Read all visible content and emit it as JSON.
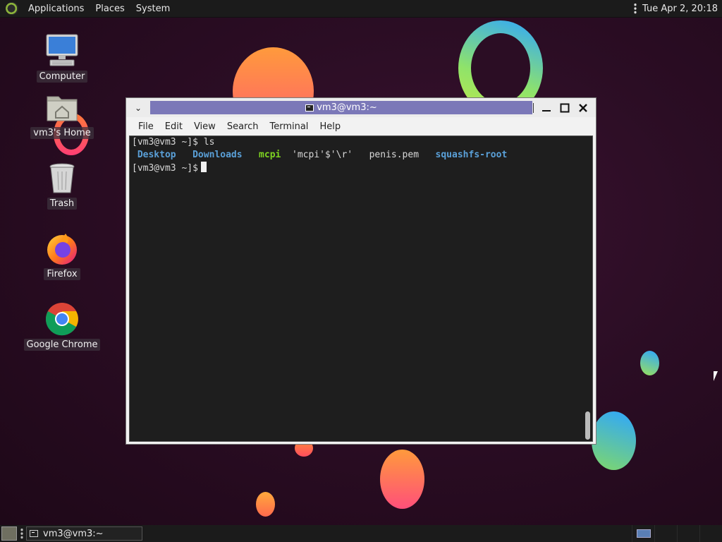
{
  "top_panel": {
    "menus": [
      "Applications",
      "Places",
      "System"
    ],
    "clock": "Tue Apr  2, 20:18"
  },
  "desktop_icons": [
    {
      "label": "Computer",
      "icon": "computer-icon"
    },
    {
      "label": "vm3's Home",
      "icon": "home-folder-icon"
    },
    {
      "label": "Trash",
      "icon": "trash-icon"
    },
    {
      "label": "Firefox",
      "icon": "firefox-icon"
    },
    {
      "label": "Google Chrome",
      "icon": "chrome-icon"
    }
  ],
  "terminal": {
    "title": "vm3@vm3:~",
    "menu": [
      "File",
      "Edit",
      "View",
      "Search",
      "Terminal",
      "Help"
    ],
    "lines": {
      "prompt1": "[vm3@vm3 ~]$ ls",
      "ls_entries": [
        {
          "name": "Desktop",
          "kind": "dir"
        },
        {
          "name": "Downloads",
          "kind": "dir"
        },
        {
          "name": "mcpi",
          "kind": "exe"
        },
        {
          "name": "'mcpi'$'\\r'",
          "kind": "file"
        },
        {
          "name": "penis.pem",
          "kind": "file"
        },
        {
          "name": "squashfs-root",
          "kind": "dir"
        }
      ],
      "prompt2": "[vm3@vm3 ~]$"
    }
  },
  "taskbar": {
    "task_label": "vm3@vm3:~"
  },
  "colors": {
    "title_bar_active": "#7b78b8",
    "dir_color": "#5aa0d8",
    "exe_color": "#7ed321"
  }
}
